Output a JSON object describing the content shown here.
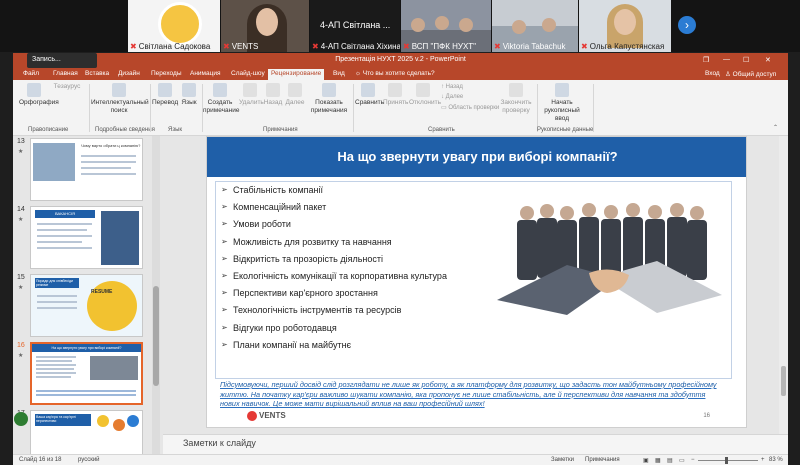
{
  "video_tiles": [
    {
      "name": "Світлана Садокова"
    },
    {
      "name": "VENTS"
    },
    {
      "name": "4-АП Світлана Хіхина"
    },
    {
      "name": "4-АП Світлана Хіхина"
    },
    {
      "name": "ВСП \"ПФК НУХТ\""
    },
    {
      "name": "Viktoria Tabachuk"
    },
    {
      "name": "Ольга Капустянская"
    }
  ],
  "overlay_title": "4-АП Світлана ...",
  "recording": "Запись...",
  "window": {
    "title": "Презентація НУХТ 2025 v.2 - PowerPoint",
    "controls": {
      "restore": "❐",
      "minimize": "—",
      "maximize": "☐",
      "close": "✕"
    }
  },
  "tabs": [
    "Файл",
    "Главная",
    "Вставка",
    "Дизайн",
    "Переходы",
    "Анимация",
    "Слайд-шоу",
    "Рецензирование",
    "Вид"
  ],
  "active_tab": "Рецензирование",
  "tell_me": "Что вы хотите сделать?",
  "signin": "Вход",
  "share": "Общий доступ",
  "ribbon": {
    "spelling": "Орфография",
    "thesaurus": "Тезаурус",
    "smart_lookup": "Интеллектуальный поиск",
    "translate": "Перевод",
    "language": "Язык",
    "new_comment": "Создать примечание",
    "delete": "Удалить",
    "previous": "Назад",
    "next": "Далее",
    "show_comments": "Показать примечания",
    "compare": "Сравнить",
    "accept": "Принять",
    "reject": "Отклонить",
    "prev_small": "Назад",
    "next_small": "Далее",
    "reviewing_pane": "Область проверки",
    "end_review": "Закончить проверку",
    "start_inking": "Начать рукописный ввод",
    "groups": {
      "proofing": "Правописание",
      "insights": "Подробные сведения",
      "language": "Язык",
      "comments": "Примечания",
      "compare": "Сравнить",
      "ink": "Рукописные данные"
    }
  },
  "thumbnails": [
    {
      "number": "13"
    },
    {
      "number": "14"
    },
    {
      "number": "15"
    },
    {
      "number": "16"
    },
    {
      "number": "17"
    }
  ],
  "thumb_texts": {
    "t13": "Чому варто обрати ц компанію?",
    "t14": "ВАКАНСІЯ",
    "t15": "Поради для співбесіди резюме",
    "t15b": "RESUME",
    "t16": "На що звернути увагу при виборі компанії?",
    "t17": "Ваша кар'єра та кар'єрні перспективи"
  },
  "slide": {
    "title": "На що звернути увагу при виборі компанії?",
    "bullets": [
      "Стабільність компанії",
      "Компенсаційний пакет",
      "Умови роботи",
      "Можливість для розвитку та навчання",
      "Відкритість та прозорість діяльності",
      "Екологічність комунікації та корпоративна культура",
      "Перспективи кар'єрного зростання",
      "Технологічність інструментів та ресурсів",
      "Відгуки про роботодавця",
      "Плани компанії на майбутнє"
    ],
    "summary": "Підсумовуючи, перший досвід слід розглядати не лише як роботу, а як платформу для розвитку, що задасть тон майбутньому професійному життю. На початку кар'єри важливо шукати компанію, яка пропонує не лише стабільність, але й перспективи для навчання та здобуття нових навичок. Це може мати вирішальний вплив на ваш професійний шлях!",
    "logo": "VENTS",
    "page_number": "16"
  },
  "notes_label": "Заметки к слайду",
  "status": {
    "slide_of": "Слайд 16 из 18",
    "language": "русский",
    "notes": "Заметки",
    "comments": "Примечания",
    "zoom": "83 %"
  }
}
